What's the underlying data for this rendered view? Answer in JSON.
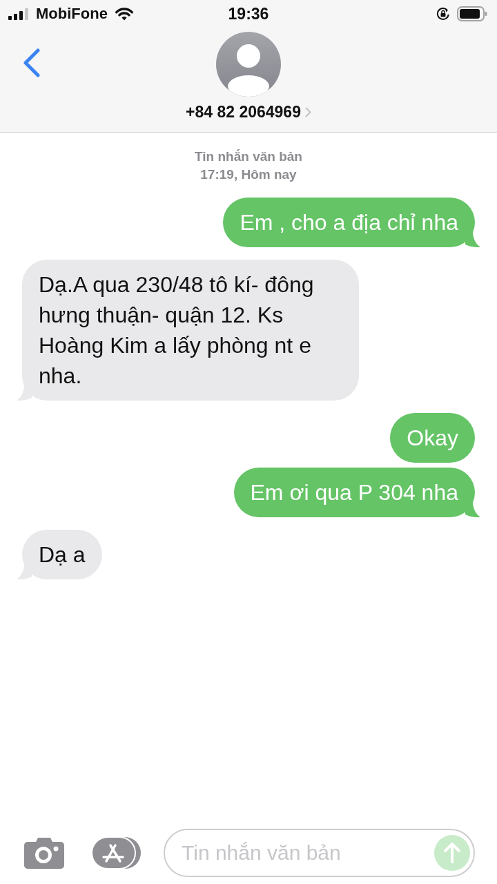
{
  "status_bar": {
    "carrier": "MobiFone",
    "time": "19:36"
  },
  "header": {
    "contact": "+84 82 2064969"
  },
  "thread_header": {
    "label": "Tin nhắn văn bản",
    "time": "17:19, Hôm nay"
  },
  "messages": [
    {
      "kind": "sent",
      "text": "Em , cho a địa chỉ nha",
      "tail": true
    },
    {
      "kind": "received",
      "text": "Dạ.A qua 230/48 tô kí- đông hưng thuận- quận 12. Ks Hoàng Kim a lấy phòng nt e nha.",
      "tail": true
    },
    {
      "kind": "sent",
      "text": "Okay",
      "tail": false
    },
    {
      "kind": "sent",
      "text": "Em ơi qua P 304 nha",
      "tail": true
    },
    {
      "kind": "received",
      "text": "Dạ a",
      "tail": true
    }
  ],
  "composer": {
    "placeholder": "Tin nhắn văn bản",
    "send_button": {
      "disabled": true
    }
  }
}
